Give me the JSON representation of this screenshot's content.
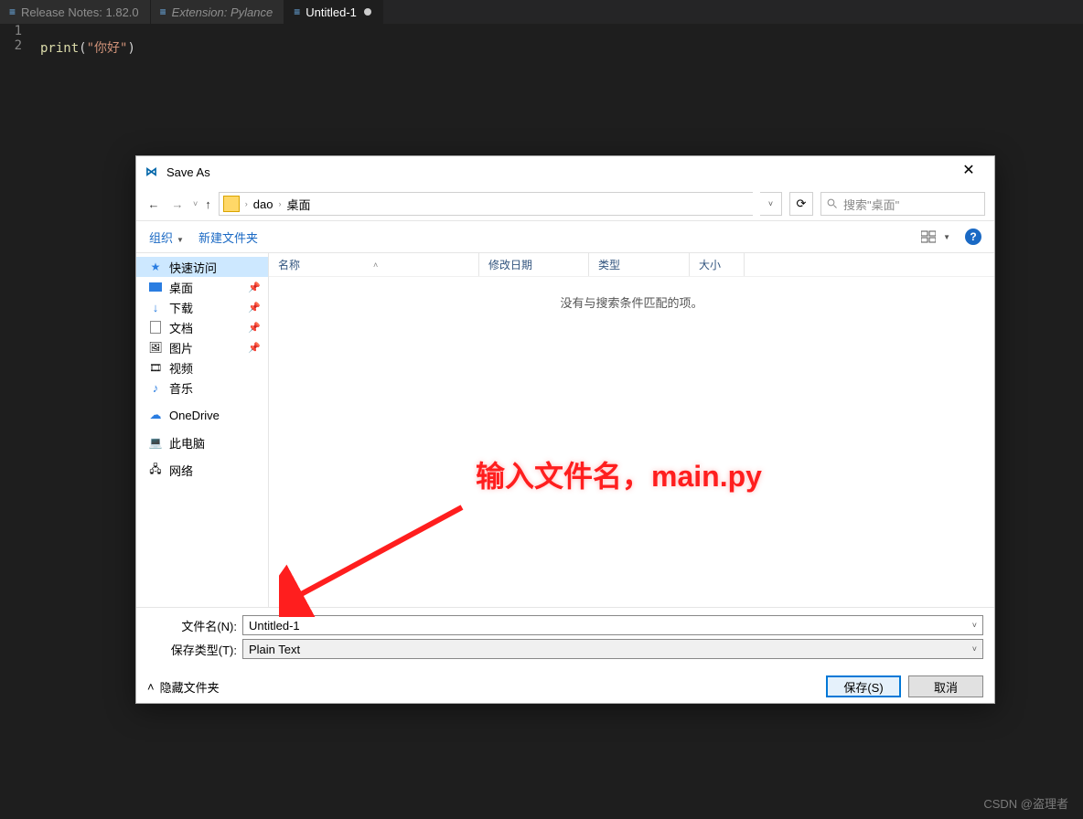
{
  "tabs": [
    {
      "label": "Release Notes: 1.82.0",
      "italic": false,
      "active": false
    },
    {
      "label": "Extension: Pylance",
      "italic": true,
      "active": false
    },
    {
      "label": "Untitled-1",
      "italic": false,
      "active": true,
      "dirty": true
    }
  ],
  "editor": {
    "lines": [
      "1",
      "2"
    ],
    "code_fn": "print",
    "code_open": "(",
    "code_str": "\"你好\"",
    "code_close": ")"
  },
  "dialog": {
    "title": "Save As",
    "path": {
      "seg1": "dao",
      "seg2": "桌面"
    },
    "search_placeholder": "搜索\"桌面\"",
    "toolbar": {
      "organize": "组织",
      "newfolder": "新建文件夹"
    },
    "columns": {
      "name": "名称",
      "date": "修改日期",
      "type": "类型",
      "size": "大小"
    },
    "empty": "没有与搜索条件匹配的项。",
    "sidebar": {
      "quick": "快速访问",
      "desktop": "桌面",
      "downloads": "下载",
      "documents": "文档",
      "pictures": "图片",
      "videos": "视频",
      "music": "音乐",
      "onedrive": "OneDrive",
      "thispc": "此电脑",
      "network": "网络"
    },
    "filename_label": "文件名(N):",
    "filename_value": "Untitled-1",
    "type_label": "保存类型(T):",
    "type_value": "Plain Text",
    "hide": "隐藏文件夹",
    "save": "保存(S)",
    "cancel": "取消"
  },
  "annotation": "输入文件名，main.py",
  "watermark": "CSDN @盗理者"
}
